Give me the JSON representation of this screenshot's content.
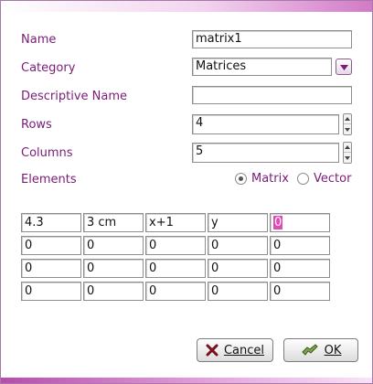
{
  "form": {
    "name_label": "Name",
    "name_value": "matrix1",
    "category_label": "Category",
    "category_value": "Matrices",
    "descriptive_label": "Descriptive Name",
    "descriptive_value": "",
    "rows_label": "Rows",
    "rows_value": "4",
    "columns_label": "Columns",
    "columns_value": "5",
    "elements_label": "Elements",
    "radio_matrix": "Matrix",
    "radio_vector": "Vector",
    "selected_radio": "Matrix"
  },
  "matrix": {
    "rows": [
      [
        "4.3",
        "3 cm",
        "x+1",
        "y",
        "0"
      ],
      [
        "0",
        "0",
        "0",
        "0",
        "0"
      ],
      [
        "0",
        "0",
        "0",
        "0",
        "0"
      ],
      [
        "0",
        "0",
        "0",
        "0",
        "0"
      ]
    ]
  },
  "buttons": {
    "cancel_label": "Cancel",
    "ok_label": "OK"
  },
  "colors": {
    "label": "#7a1c78",
    "highlight": "#e24bb7"
  }
}
